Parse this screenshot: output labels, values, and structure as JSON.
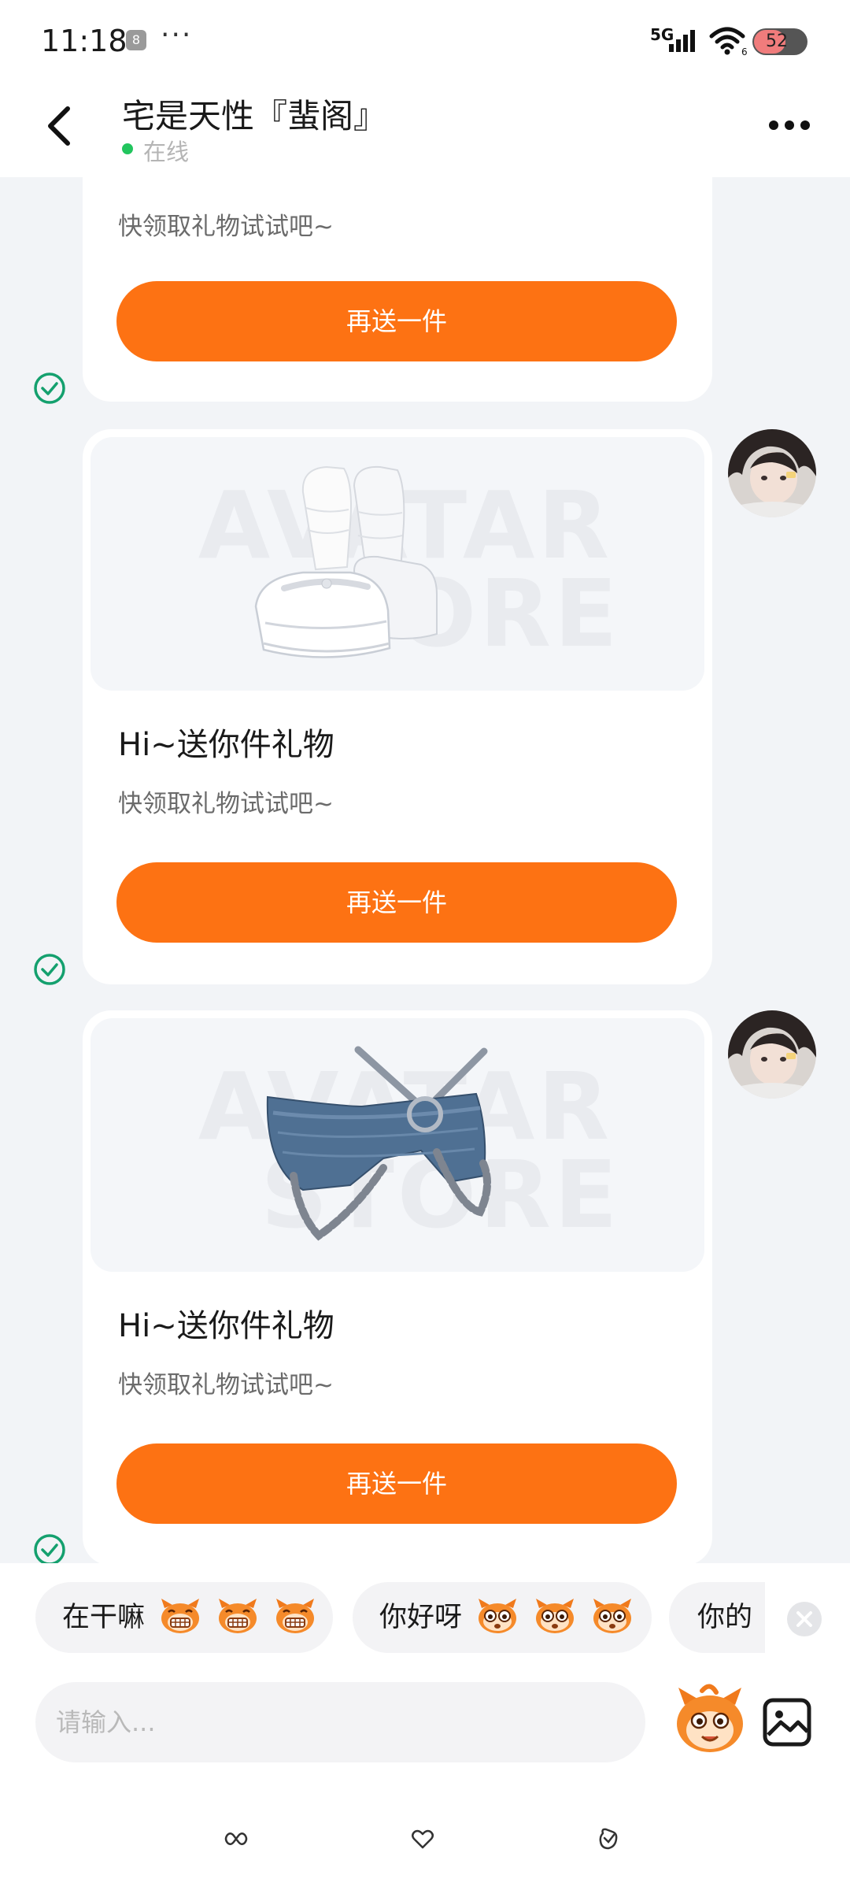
{
  "status_bar": {
    "time": "11:18",
    "app_icon_glyph": "8",
    "dots": "···",
    "network": "5G",
    "battery": "52"
  },
  "header": {
    "title": "宅是天性『蜚阁』",
    "status": "在线"
  },
  "cards": [
    {
      "title": "",
      "subtitle": "快领取礼物试试吧~",
      "button_label": "再送一件"
    },
    {
      "title": "Hi~送你件礼物",
      "subtitle": "快领取礼物试试吧~",
      "button_label": "再送一件",
      "item": "white-platform-shoes"
    },
    {
      "title": "Hi~送你件礼物",
      "subtitle": "快领取礼物试试吧~",
      "button_label": "再送一件",
      "item": "denim-chain-shorts"
    }
  ],
  "watermark": {
    "line1": "AVATAR",
    "line2": "STORE"
  },
  "quick_replies": [
    "在干嘛",
    "你好呀",
    "你的"
  ],
  "input": {
    "placeholder": "请输入..."
  },
  "colors": {
    "accent": "#fd7213",
    "online": "#22c55e",
    "check": "#14a06e"
  },
  "icons": {
    "back": "back-arrow-icon",
    "more": "more-icon",
    "check": "check-circle-icon",
    "close": "close-icon",
    "emoji": "emoji-mascot-icon",
    "image": "image-icon"
  }
}
